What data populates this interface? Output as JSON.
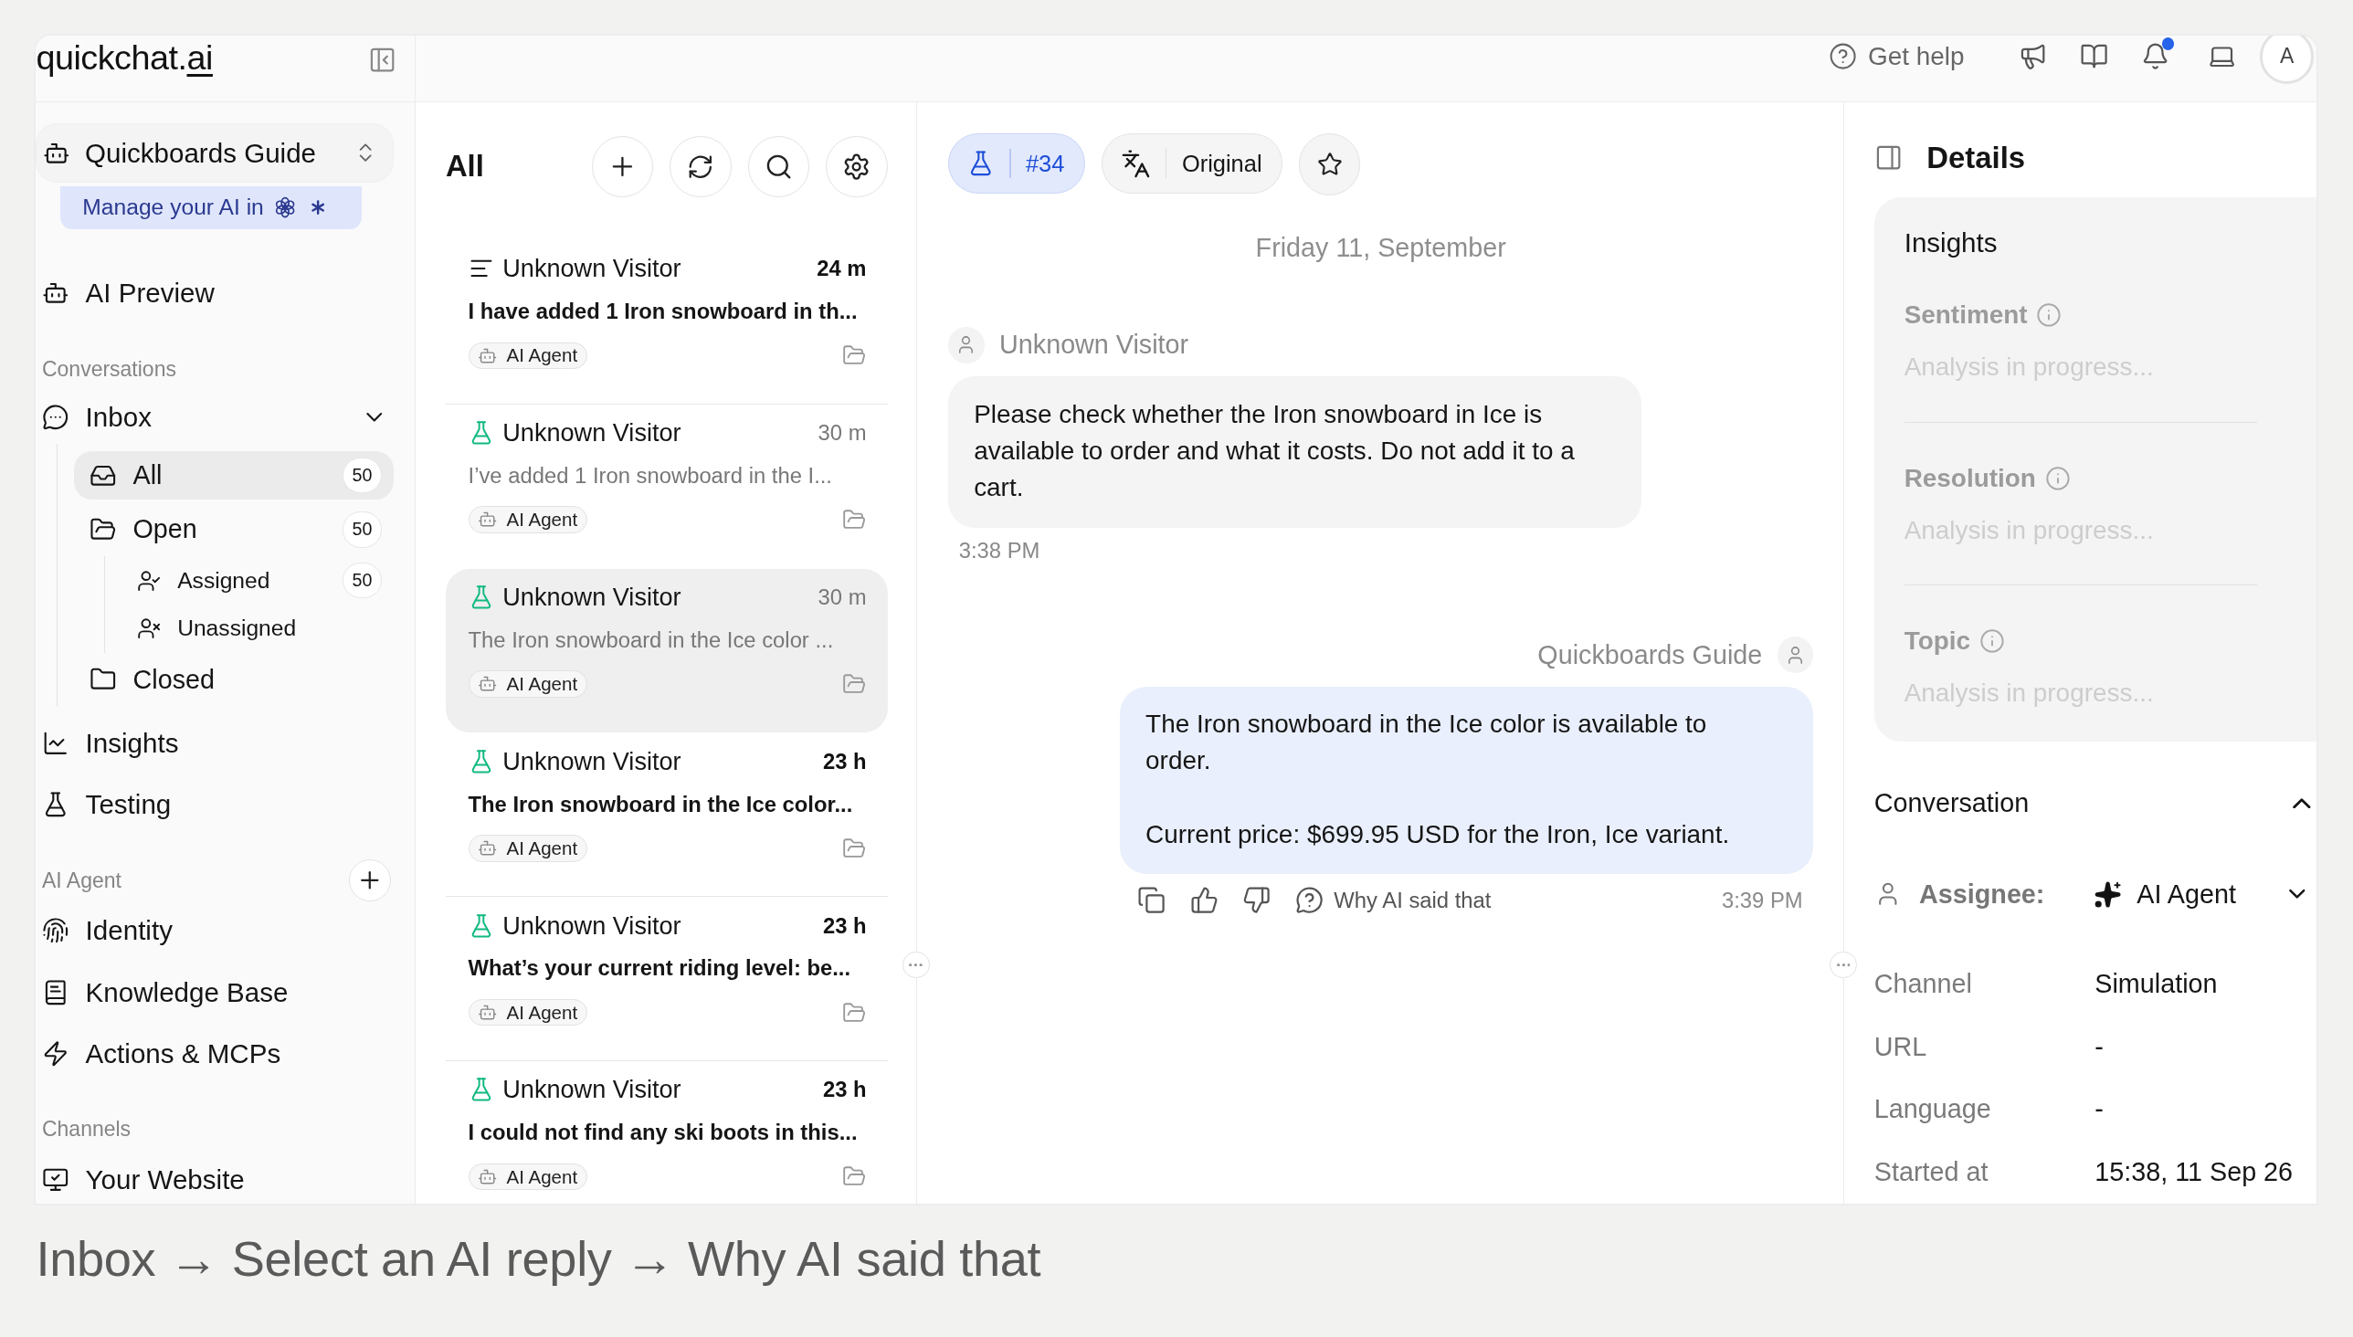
{
  "logo": {
    "text": "quickchat.",
    "accent": "ai"
  },
  "topbar": {
    "help": "Get help",
    "avatar": "A",
    "notification_unread": true
  },
  "workspace": {
    "name": "Quickboards Guide",
    "manage_label": "Manage your AI in"
  },
  "sidebar": {
    "preview": {
      "label": "AI Preview"
    },
    "conversations": {
      "title": "Conversations",
      "inbox": {
        "label": "Inbox",
        "expanded": true,
        "children": [
          {
            "label": "All",
            "count": "50",
            "selected": true
          },
          {
            "label": "Open",
            "count": "50",
            "selected": false,
            "children": [
              {
                "label": "Assigned",
                "count": "50",
                "selected": false
              },
              {
                "label": "Unassigned",
                "selected": false
              }
            ]
          },
          {
            "label": "Closed",
            "selected": false
          }
        ]
      },
      "items": [
        {
          "label": "Insights"
        },
        {
          "label": "Testing"
        }
      ]
    },
    "ai_agent": {
      "title": "AI Agent",
      "items": [
        {
          "label": "Identity"
        },
        {
          "label": "Knowledge Base"
        },
        {
          "label": "Actions & MCPs"
        }
      ]
    },
    "channels": {
      "title": "Channels",
      "items": [
        {
          "label": "Your Website"
        }
      ]
    }
  },
  "list": {
    "title": "All",
    "conversations": [
      {
        "kind": "list",
        "name": "Unknown Visitor",
        "time": "24 m",
        "preview": "I have added 1 Iron snowboard in th...",
        "tag": "AI Agent",
        "unread": true,
        "selected": false
      },
      {
        "kind": "flask",
        "name": "Unknown Visitor",
        "time": "30 m",
        "preview": "I’ve added 1 Iron snowboard in the I...",
        "tag": "AI Agent",
        "unread": false,
        "selected": false
      },
      {
        "kind": "flask",
        "name": "Unknown Visitor",
        "time": "30 m",
        "preview": "The Iron snowboard in the Ice color ...",
        "tag": "AI Agent",
        "unread": false,
        "selected": true
      },
      {
        "kind": "flask",
        "name": "Unknown Visitor",
        "time": "23 h",
        "preview": "The Iron snowboard in the Ice color...",
        "tag": "AI Agent",
        "unread": true,
        "selected": false
      },
      {
        "kind": "flask",
        "name": "Unknown Visitor",
        "time": "23 h",
        "preview": "What’s your current riding level: be...",
        "tag": "AI Agent",
        "unread": true,
        "selected": false
      },
      {
        "kind": "flask",
        "name": "Unknown Visitor",
        "time": "23 h",
        "preview": "I could not find any ski boots in this...",
        "tag": "AI Agent",
        "unread": true,
        "selected": false
      }
    ]
  },
  "chat": {
    "ticket": "#34",
    "translation": "Original",
    "starred": false,
    "date": "Friday 11, September",
    "messages": [
      {
        "kind": "visitor",
        "author": "Unknown Visitor",
        "text": "Please check whether the Iron snowboard in Ice is available to order and what it costs. Do not add it to a cart.",
        "time": "3:38 PM"
      },
      {
        "kind": "agent",
        "author": "Quickboards Guide",
        "text": "The Iron snowboard in the Ice color is available to order.\n\nCurrent price: $699.95 USD for the Iron, Ice variant.",
        "time": "3:39 PM",
        "why_label": "Why AI said that"
      }
    ]
  },
  "details": {
    "title": "Details",
    "insights": {
      "title": "Insights",
      "items": [
        {
          "label": "Sentiment",
          "value": "Analysis in progress..."
        },
        {
          "label": "Resolution",
          "value": "Analysis in progress..."
        },
        {
          "label": "Topic",
          "value": "Analysis in progress..."
        }
      ]
    },
    "conversation": {
      "title": "Conversation",
      "expanded": true,
      "assignee": {
        "label": "Assignee:",
        "value": "AI Agent"
      },
      "fields": [
        {
          "label": "Channel",
          "value": "Simulation"
        },
        {
          "label": "URL",
          "value": "-"
        },
        {
          "label": "Language",
          "value": "-"
        },
        {
          "label": "Started at",
          "value": "15:38, 11 Sep 26"
        }
      ]
    }
  },
  "caption": "Inbox → Select an AI reply → Why AI said that"
}
